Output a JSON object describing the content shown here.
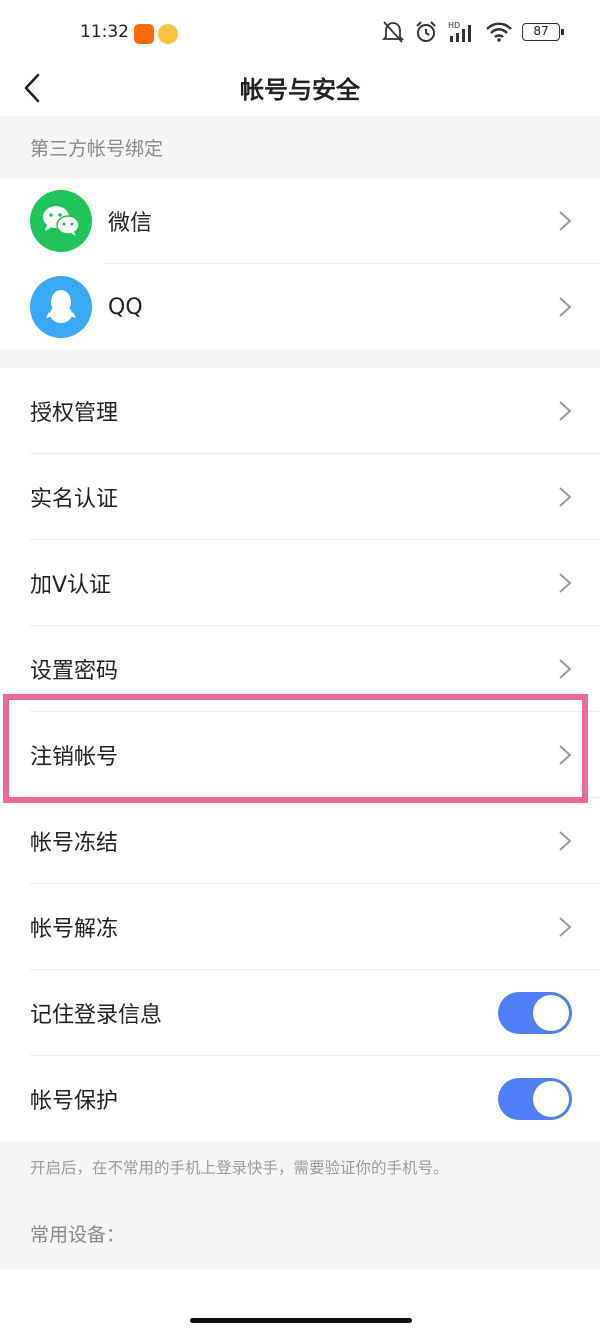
{
  "status_bar": {
    "time": "11:32",
    "battery": "87",
    "hd_label": "HD"
  },
  "nav": {
    "title": "帐号与安全"
  },
  "third_party": {
    "header": "第三方帐号绑定",
    "items": [
      {
        "label": "微信",
        "icon": "wechat-icon"
      },
      {
        "label": "QQ",
        "icon": "qq-icon"
      }
    ]
  },
  "settings": {
    "items": [
      {
        "label": "授权管理"
      },
      {
        "label": "实名认证"
      },
      {
        "label": "加V认证"
      },
      {
        "label": "设置密码"
      },
      {
        "label": "注销帐号"
      },
      {
        "label": "帐号冻结"
      },
      {
        "label": "帐号解冻"
      }
    ],
    "toggles": [
      {
        "label": "记住登录信息",
        "on": true
      },
      {
        "label": "帐号保护",
        "on": true
      }
    ]
  },
  "hint": "开启后，在不常用的手机上登录快手，需要验证你的手机号。",
  "devices_header": "常用设备：",
  "colors": {
    "accent": "#4f7ef7",
    "wechat": "#1fc55a",
    "qq": "#3aa9f5",
    "highlight": "#f06b93"
  }
}
